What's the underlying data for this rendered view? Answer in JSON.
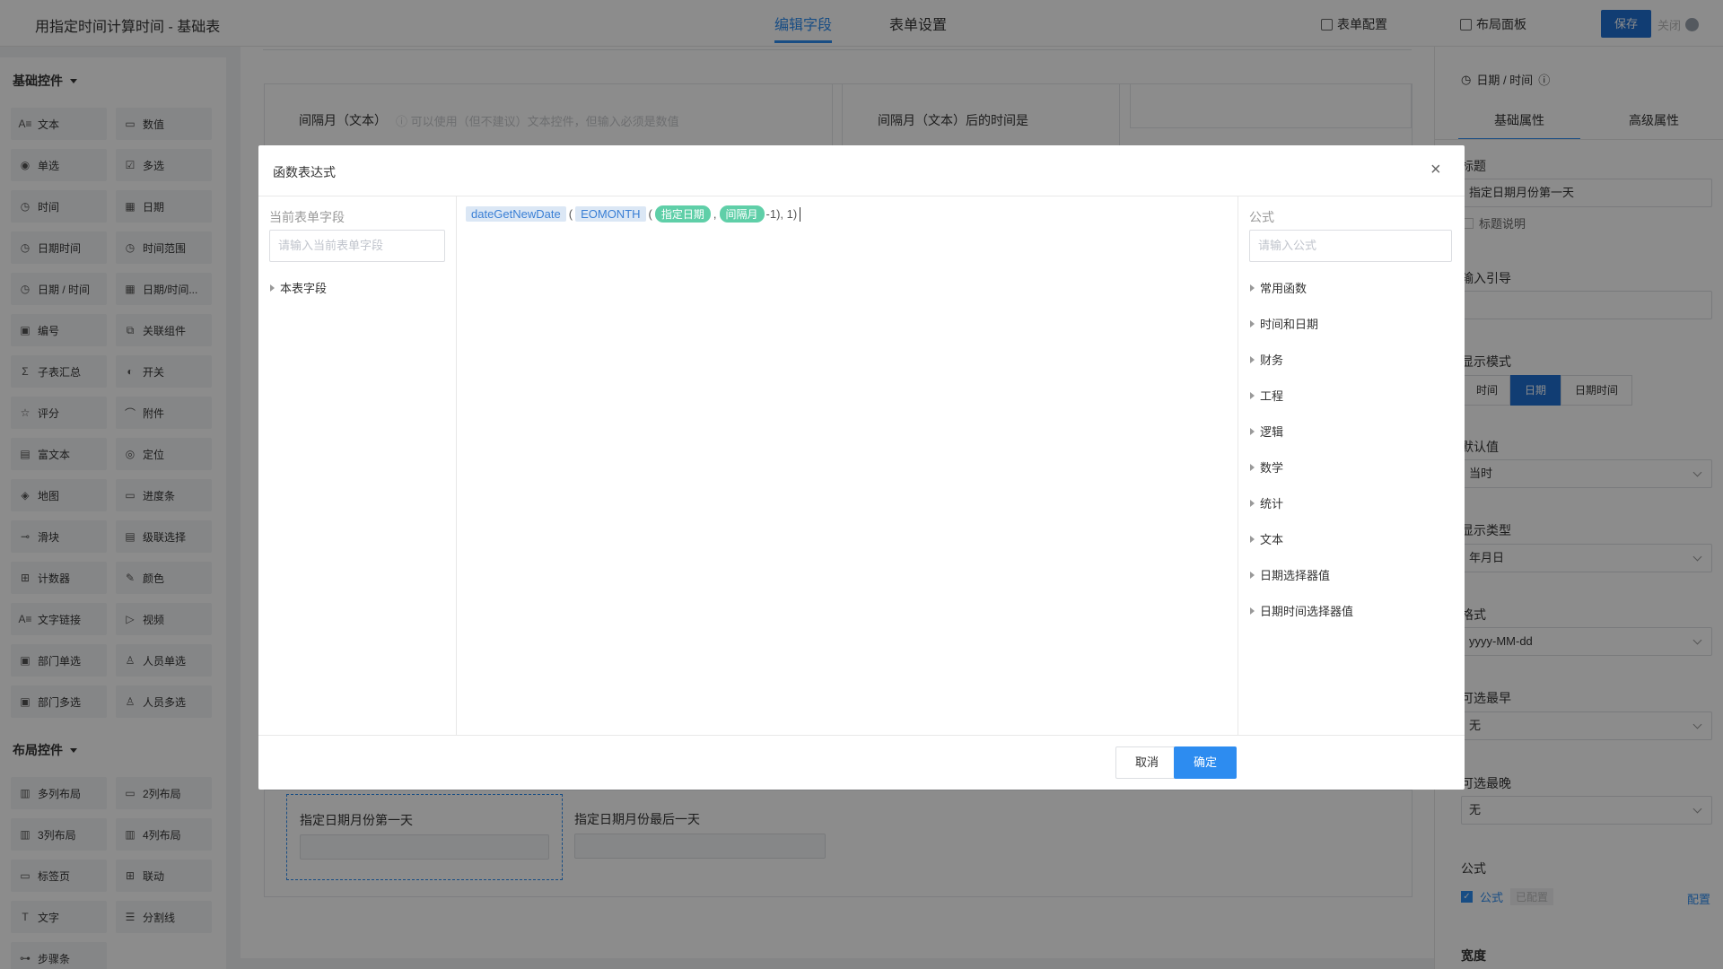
{
  "app_title": "用指定时间计算时间 - 基础表",
  "top_tabs": [
    "编辑字段",
    "表单设置"
  ],
  "toolbar": {
    "form_config": "表单配置",
    "layout_panel": "布局面板",
    "save": "保存",
    "close": "关闭"
  },
  "left": {
    "basic_title": "基础控件",
    "basic_items": [
      {
        "label": "文本",
        "icon": "A≡"
      },
      {
        "label": "数值",
        "icon": "▭"
      },
      {
        "label": "单选",
        "icon": "◉"
      },
      {
        "label": "多选",
        "icon": "☑"
      },
      {
        "label": "时间",
        "icon": "◷"
      },
      {
        "label": "日期",
        "icon": "▦"
      },
      {
        "label": "日期时间",
        "icon": "◷"
      },
      {
        "label": "时间范围",
        "icon": "◷"
      },
      {
        "label": "日期 / 时间",
        "icon": "◷"
      },
      {
        "label": "日期/时间...",
        "icon": "▦"
      },
      {
        "label": "编号",
        "icon": "▣"
      },
      {
        "label": "关联组件",
        "icon": "⧉"
      },
      {
        "label": "子表汇总",
        "icon": "Σ"
      },
      {
        "label": "开关",
        "icon": "◐"
      },
      {
        "label": "评分",
        "icon": "☆"
      },
      {
        "label": "附件",
        "icon": "⌒"
      },
      {
        "label": "富文本",
        "icon": "▤"
      },
      {
        "label": "定位",
        "icon": "◎"
      },
      {
        "label": "地图",
        "icon": "◈"
      },
      {
        "label": "进度条",
        "icon": "▭"
      },
      {
        "label": "滑块",
        "icon": "⊸"
      },
      {
        "label": "级联选择",
        "icon": "▤"
      },
      {
        "label": "计数器",
        "icon": "⊞"
      },
      {
        "label": "颜色",
        "icon": "✎"
      },
      {
        "label": "文字链接",
        "icon": "A≡"
      },
      {
        "label": "视频",
        "icon": "▷"
      },
      {
        "label": "部门单选",
        "icon": "▣"
      },
      {
        "label": "人员单选",
        "icon": "♙"
      },
      {
        "label": "部门多选",
        "icon": "▣"
      },
      {
        "label": "人员多选",
        "icon": "♙"
      }
    ],
    "layout_title": "布局控件",
    "layout_items": [
      {
        "label": "多列布局",
        "icon": "▥"
      },
      {
        "label": "2列布局",
        "icon": "▭"
      },
      {
        "label": "3列布局",
        "icon": "▥"
      },
      {
        "label": "4列布局",
        "icon": "▥"
      },
      {
        "label": "标签页",
        "icon": "▭"
      },
      {
        "label": "联动",
        "icon": "⊞"
      },
      {
        "label": "文字",
        "icon": "T"
      },
      {
        "label": "分割线",
        "icon": "☰"
      },
      {
        "label": "步骤条",
        "icon": "⊶"
      }
    ]
  },
  "canvas": {
    "field1_label": "间隔月（文本）",
    "field1_hint": "可以使用（但不建议）文本控件，但输入必须是数值",
    "field2_label": "间隔月（文本）后的时间是",
    "field3_label": "指定日期月份第一天",
    "field4_label": "指定日期月份最后一天"
  },
  "right": {
    "header": "日期 / 时间",
    "tabs": [
      "基础属性",
      "高级属性"
    ],
    "title_label": "标题",
    "title_value": "指定日期月份第一天",
    "title_desc": "标题说明",
    "input_guide": "输入引导",
    "display_mode": "显示模式",
    "mode_options": [
      "时间",
      "日期",
      "日期时间"
    ],
    "default_label": "默认值",
    "default_value": "当时",
    "display_type_label": "显示类型",
    "display_type_value": "年月日",
    "format_label": "格式",
    "format_value": "yyyy-MM-dd",
    "earliest_label": "可选最早",
    "earliest_value": "无",
    "latest_label": "可选最晚",
    "latest_value": "无",
    "formula_section": "公式",
    "formula_checkbox": "公式",
    "formula_badge": "已配置",
    "formula_config": "配置",
    "width_label": "宽度"
  },
  "modal": {
    "title": "函数表达式",
    "left_label": "当前表单字段",
    "left_placeholder": "请输入当前表单字段",
    "left_tree": [
      "本表字段"
    ],
    "expr": {
      "fn1": "dateGetNewDate",
      "p1": "(",
      "fn2": "EOMONTH",
      "p2": "(",
      "field1": "指定日期",
      "sep": ",",
      "field2": "间隔月",
      "tail": "-1), 1)"
    },
    "right_label": "公式",
    "right_placeholder": "请输入公式",
    "right_tree": [
      "常用函数",
      "时间和日期",
      "财务",
      "工程",
      "逻辑",
      "数学",
      "统计",
      "文本",
      "日期选择器值",
      "日期时间选择器值"
    ],
    "cancel": "取消",
    "ok": "确定"
  }
}
